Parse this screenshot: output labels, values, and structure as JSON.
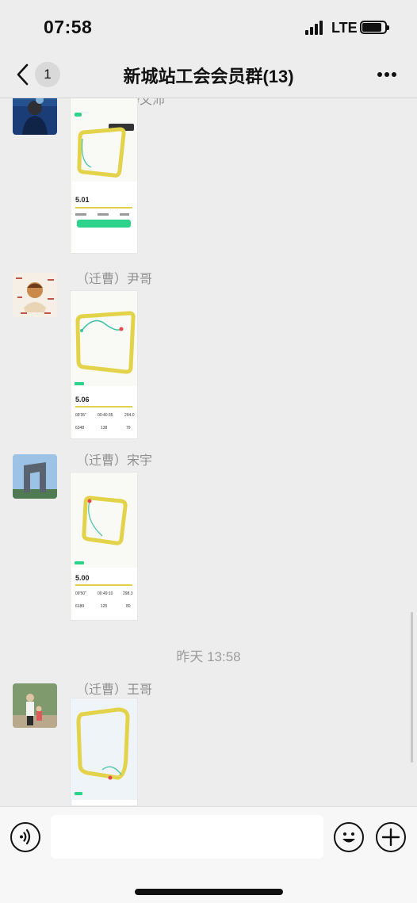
{
  "status_bar": {
    "time": "07:58",
    "carrier": "LTE",
    "battery_level": 0.85
  },
  "nav": {
    "unread_count": "1",
    "title": "新城站工会会员群(13)",
    "back_icon": "chevron-left-icon",
    "more_icon": "more-horizontal-icon"
  },
  "messages": [
    {
      "sender": "（迁曹）静文沛",
      "shot": {
        "distance": "5.01",
        "time": "",
        "pace": ""
      }
    },
    {
      "sender": "（迁曹）尹哥",
      "shot": {
        "distance": "5.06",
        "time": "00:40:35",
        "pace": "09'35\"",
        "calories": "294.0",
        "steps": "6348",
        "cadence": "138",
        "stride": "79"
      }
    },
    {
      "sender": "（迁曹）宋宇",
      "shot": {
        "distance": "5.00",
        "time": "00:49:10",
        "pace": "09'50\"",
        "calories": "298.3",
        "steps": "6189",
        "cadence": "125",
        "stride": "80"
      }
    },
    {
      "sender": "（迁曹）王哥",
      "shot": {}
    }
  ],
  "divider_time": "昨天 13:58",
  "input": {
    "placeholder": "",
    "voice_icon": "voice-icon",
    "emoji_icon": "emoji-icon",
    "plus_icon": "plus-icon"
  },
  "colors": {
    "background": "#ededed",
    "route_yellow": "#e3d34a",
    "app_green": "#2dd38b"
  }
}
